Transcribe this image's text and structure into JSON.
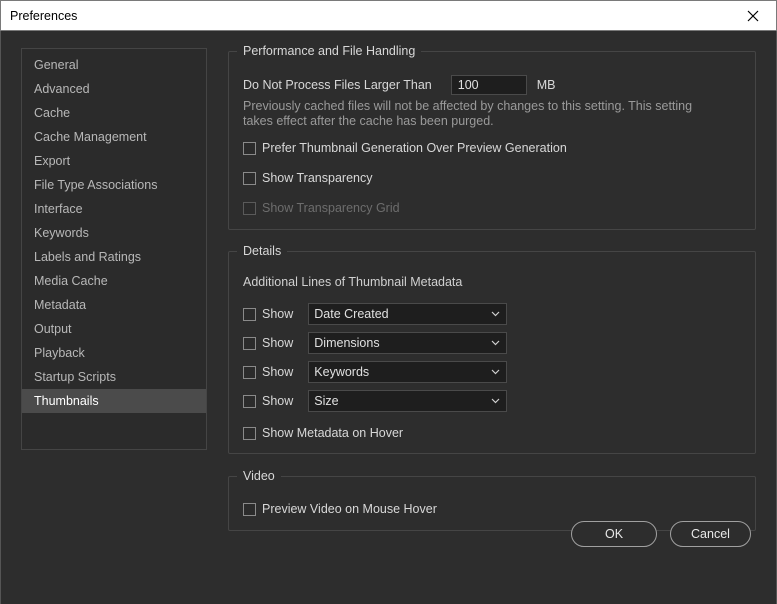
{
  "window": {
    "title": "Preferences",
    "close_icon": "close-icon"
  },
  "sidebar": {
    "items": [
      {
        "label": "General"
      },
      {
        "label": "Advanced"
      },
      {
        "label": "Cache"
      },
      {
        "label": "Cache Management"
      },
      {
        "label": "Export"
      },
      {
        "label": "File Type Associations"
      },
      {
        "label": "Interface"
      },
      {
        "label": "Keywords"
      },
      {
        "label": "Labels and Ratings"
      },
      {
        "label": "Media Cache"
      },
      {
        "label": "Metadata"
      },
      {
        "label": "Output"
      },
      {
        "label": "Playback"
      },
      {
        "label": "Startup Scripts"
      },
      {
        "label": "Thumbnails",
        "selected": true
      }
    ]
  },
  "performance": {
    "title": "Performance and File Handling",
    "max_size_label": "Do Not Process Files Larger Than",
    "max_size_value": "100",
    "max_size_unit": "MB",
    "note_line1": "Previously cached files will not be affected by changes to this setting. This setting",
    "note_line2": "takes effect after the cache has been purged.",
    "prefer_thumbnail_label": "Prefer Thumbnail Generation Over Preview Generation",
    "prefer_thumbnail_checked": false,
    "show_transparency_label": "Show Transparency",
    "show_transparency_checked": false,
    "show_transparency_grid_label": "Show Transparency Grid",
    "show_transparency_grid_checked": false,
    "show_transparency_grid_enabled": false
  },
  "details": {
    "title": "Details",
    "subtitle": "Additional Lines of Thumbnail Metadata",
    "lines": [
      {
        "show_label": "Show",
        "checked": false,
        "value": "Date Created"
      },
      {
        "show_label": "Show",
        "checked": false,
        "value": "Dimensions"
      },
      {
        "show_label": "Show",
        "checked": false,
        "value": "Keywords"
      },
      {
        "show_label": "Show",
        "checked": false,
        "value": "Size"
      }
    ],
    "hover_label": "Show Metadata on Hover",
    "hover_checked": false
  },
  "video": {
    "title": "Video",
    "preview_label": "Preview Video on Mouse Hover",
    "preview_checked": false
  },
  "buttons": {
    "ok": "OK",
    "cancel": "Cancel"
  },
  "colors": {
    "background": "#2d2d2d",
    "selected_item": "#4b4b4b",
    "border": "#454545"
  }
}
